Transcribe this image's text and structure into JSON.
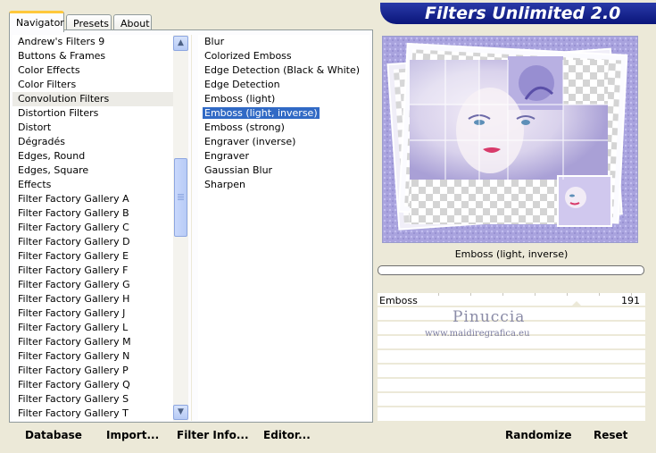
{
  "tabs": [
    {
      "label": "Navigator"
    },
    {
      "label": "Presets"
    },
    {
      "label": "About"
    }
  ],
  "banner": {
    "title": "Filters Unlimited 2.0"
  },
  "categories": [
    "Andrew's Filters 9",
    "Buttons & Frames",
    "Color Effects",
    "Color Filters",
    "Convolution Filters",
    "Distortion Filters",
    "Distort",
    "Dégradés",
    "Edges, Round",
    "Edges, Square",
    "Effects",
    "Filter Factory Gallery A",
    "Filter Factory Gallery B",
    "Filter Factory Gallery C",
    "Filter Factory Gallery D",
    "Filter Factory Gallery E",
    "Filter Factory Gallery F",
    "Filter Factory Gallery G",
    "Filter Factory Gallery H",
    "Filter Factory Gallery J",
    "Filter Factory Gallery L",
    "Filter Factory Gallery M",
    "Filter Factory Gallery N",
    "Filter Factory Gallery P",
    "Filter Factory Gallery Q",
    "Filter Factory Gallery S",
    "Filter Factory Gallery T"
  ],
  "selected_category": "Convolution Filters",
  "filters": [
    "Blur",
    "Colorized Emboss",
    "Edge Detection (Black & White)",
    "Edge Detection",
    "Emboss (light)",
    "Emboss (light, inverse)",
    "Emboss (strong)",
    "Engraver (inverse)",
    "Engraver",
    "Gaussian Blur",
    "Sharpen"
  ],
  "selected_filter": "Emboss (light, inverse)",
  "current_filter_label": "Emboss (light, inverse)",
  "parameter": {
    "label": "Emboss",
    "value": "191"
  },
  "watermark": {
    "line1": "Pinuccia",
    "line2": "www.maidiregrafica.eu"
  },
  "buttons": {
    "database": "Database",
    "import": "Import...",
    "filter_info": "Filter Info...",
    "editor": "Editor...",
    "randomize": "Randomize",
    "reset": "Reset"
  },
  "colors": {
    "selection": "#316ac5",
    "banner": "#0a157a",
    "preview_frame": "#a9a3de"
  },
  "icons": {
    "scroll_up": "▲",
    "scroll_down": "▼"
  }
}
